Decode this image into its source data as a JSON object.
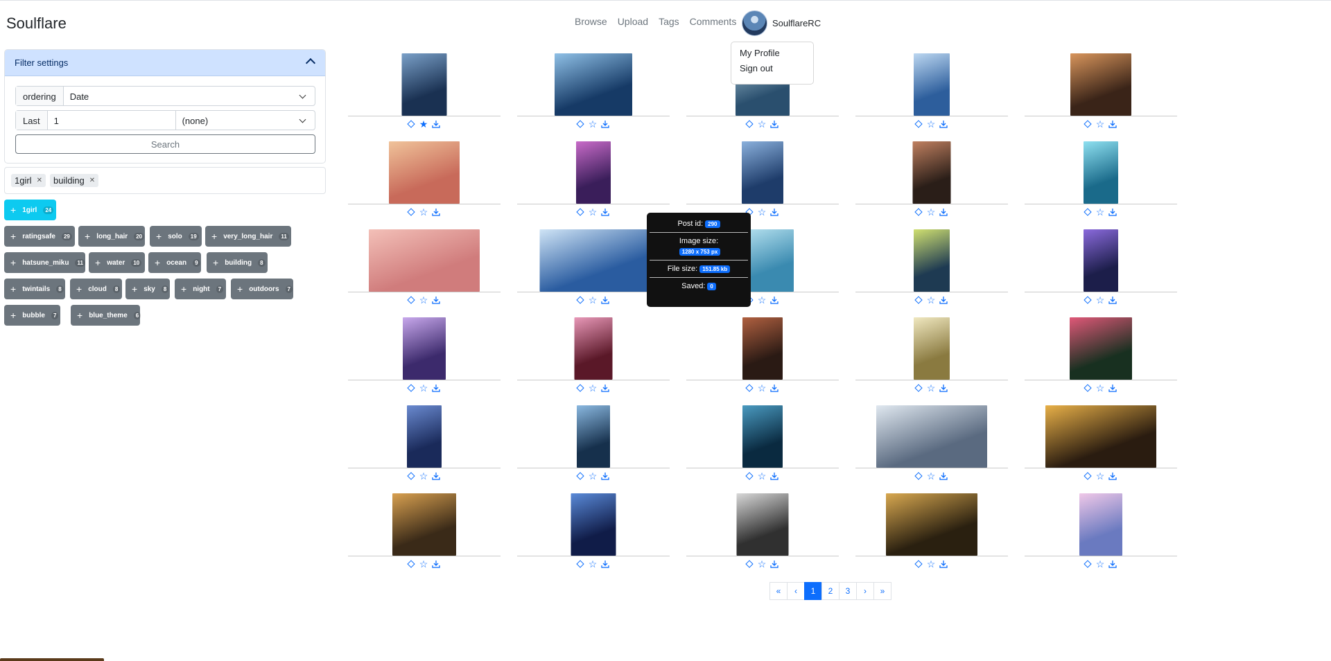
{
  "brand": "Soulflare",
  "nav": {
    "browse": "Browse",
    "upload": "Upload",
    "tags": "Tags",
    "comments": "Comments"
  },
  "user": {
    "name": "SoulflareRC"
  },
  "dropdown": {
    "profile": "My Profile",
    "signout": "Sign out"
  },
  "filter": {
    "title": "Filter settings",
    "ordering_label": "ordering",
    "ordering_value": "Date",
    "last_label": "Last",
    "last_value": "1",
    "period_value": "(none)",
    "search_label": "Search"
  },
  "selected_tags": [
    {
      "label": "1girl"
    },
    {
      "label": "building"
    }
  ],
  "tag_cloud": [
    {
      "label": "1girl",
      "count": "24"
    },
    {
      "label": "ratingsafe",
      "count": "29"
    },
    {
      "label": "long_hair",
      "count": "20"
    },
    {
      "label": "solo",
      "count": "19"
    },
    {
      "label": "very_long_hair",
      "count": "11"
    },
    {
      "label": "hatsune_miku",
      "count": "11"
    },
    {
      "label": "water",
      "count": "10"
    },
    {
      "label": "ocean",
      "count": "9"
    },
    {
      "label": "building",
      "count": "8"
    },
    {
      "label": "twintails",
      "count": "8"
    },
    {
      "label": "cloud",
      "count": "8"
    },
    {
      "label": "sky",
      "count": "8"
    },
    {
      "label": "night",
      "count": "7"
    },
    {
      "label": "outdoors",
      "count": "7"
    },
    {
      "label": "bubble",
      "count": "7"
    },
    {
      "label": "blue_theme",
      "count": "6"
    }
  ],
  "tooltip": {
    "post_id_label": "Post id:",
    "post_id": "290",
    "image_size_label": "Image size:",
    "image_size": "1280 x 753 px",
    "file_size_label": "File size:",
    "file_size": "151.85 kb",
    "saved_label": "Saved:",
    "saved": "0"
  },
  "pagination": {
    "first": "«",
    "prev": "‹",
    "pages": [
      "1",
      "2",
      "3"
    ],
    "next": "›",
    "last": "»",
    "current": "1"
  },
  "colors": {
    "primary": "#0d6efd",
    "secondary": "#6c757d",
    "info": "#0dcaf0",
    "filter_header": "#cfe2ff"
  },
  "favorited_post_index": 0
}
